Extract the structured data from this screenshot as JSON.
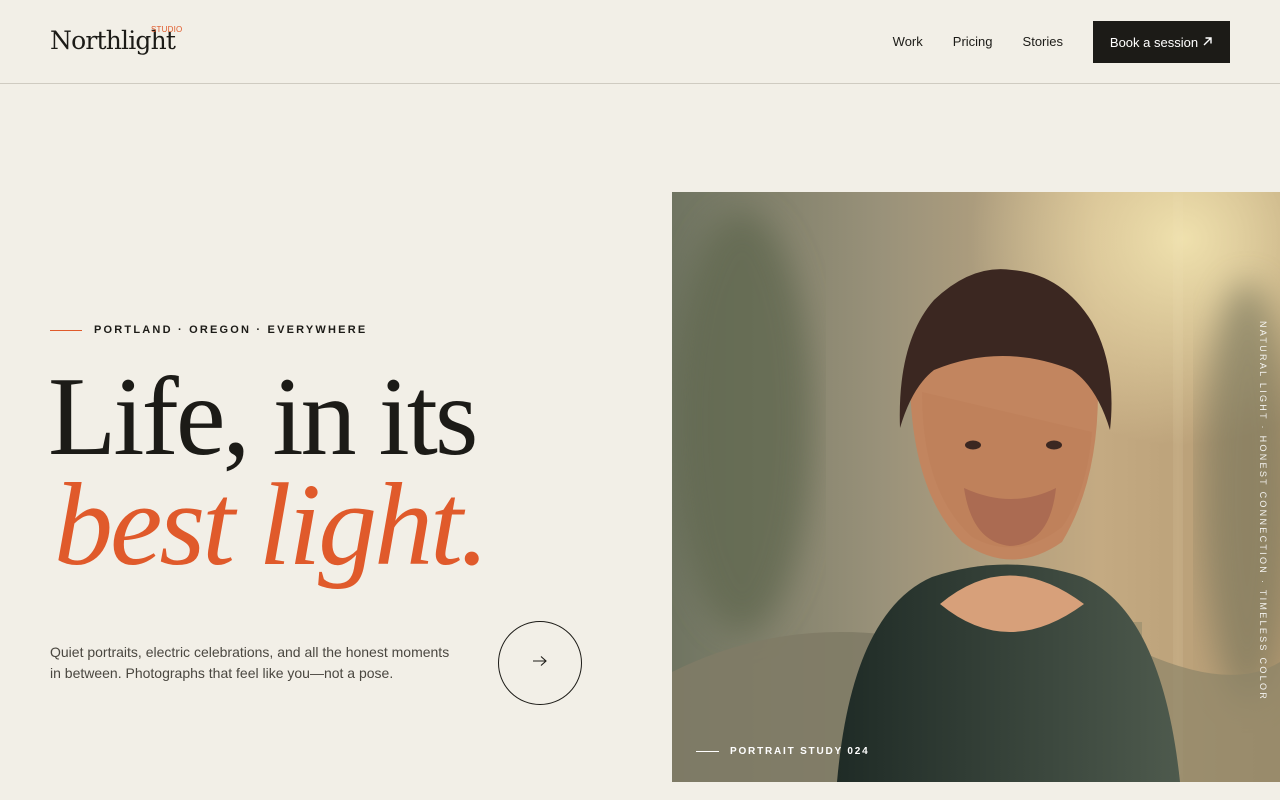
{
  "brand": {
    "name": "Northlight",
    "tag": "STUDIO"
  },
  "nav": {
    "items": [
      "Work",
      "Pricing",
      "Stories"
    ],
    "cta_label": "Book a session",
    "cta_icon": "arrow-up-right-icon"
  },
  "hero": {
    "eyebrow": "PORTLAND · OREGON · EVERYWHERE",
    "headline_line1": "Life, in its",
    "headline_line2": "best light.",
    "lede": "Quiet portraits, electric celebrations, and all the honest moments in between. Photographs that feel like you—not a pose.",
    "next_icon": "arrow-right-icon"
  },
  "photo": {
    "vertical_caption": "NATURAL LIGHT · HONEST CONNECTION · TIMELESS COLOR",
    "caption": "PORTRAIT STUDY 024"
  },
  "colors": {
    "background": "#f2efe7",
    "ink": "#1c1b17",
    "accent": "#e05a2b"
  }
}
